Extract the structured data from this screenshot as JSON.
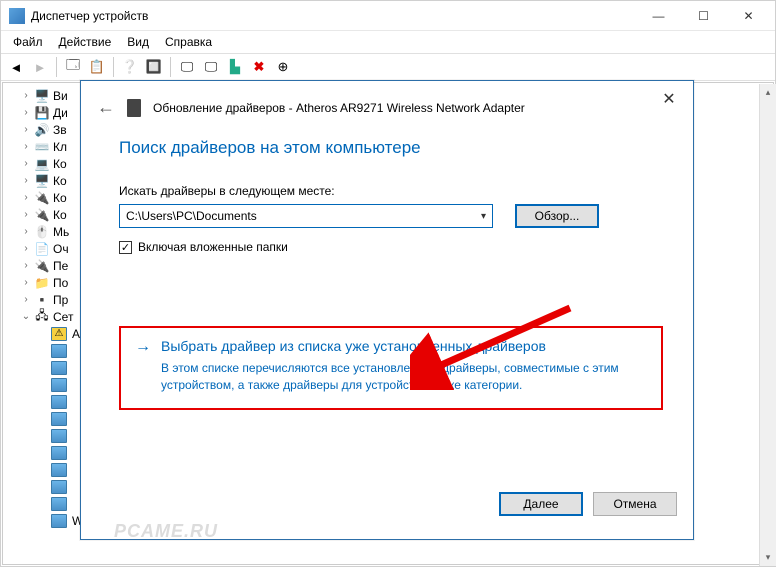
{
  "window": {
    "title": "Диспетчер устройств"
  },
  "menu": {
    "file": "Файл",
    "action": "Действие",
    "view": "Вид",
    "help": "Справка"
  },
  "tree": {
    "items": [
      {
        "label": "Ви",
        "icon": "🖥️"
      },
      {
        "label": "Ди",
        "icon": "💾"
      },
      {
        "label": "Зв",
        "icon": "🔊"
      },
      {
        "label": "Кл",
        "icon": "⌨️"
      },
      {
        "label": "Ко",
        "icon": "💻"
      },
      {
        "label": "Ко",
        "icon": "🖥️"
      },
      {
        "label": "Ко",
        "icon": "🔌"
      },
      {
        "label": "Ко",
        "icon": "🔌"
      },
      {
        "label": "Мь",
        "icon": "🖱️"
      },
      {
        "label": "Оч",
        "icon": "📄"
      },
      {
        "label": "Пе",
        "icon": "🔌"
      },
      {
        "label": "По",
        "icon": "📁"
      },
      {
        "label": "Пр",
        "icon": "▪️"
      },
      {
        "label": "Сет",
        "icon": "🖧",
        "expanded": true
      },
      {
        "label": "A",
        "child": true,
        "warn": true
      },
      {
        "label": "",
        "child": true
      },
      {
        "label": "",
        "child": true
      },
      {
        "label": "",
        "child": true
      },
      {
        "label": "",
        "child": true
      },
      {
        "label": "",
        "child": true
      },
      {
        "label": "",
        "child": true
      },
      {
        "label": "",
        "child": true
      },
      {
        "label": "",
        "child": true
      },
      {
        "label": "",
        "child": true
      },
      {
        "label": "",
        "child": true
      },
      {
        "label": "WAN Miniport (PPTP)",
        "child": true
      }
    ]
  },
  "dialog": {
    "title": "Обновление драйверов - Atheros AR9271 Wireless Network Adapter",
    "heading": "Поиск драйверов на этом компьютере",
    "path_label": "Искать драйверы в следующем месте:",
    "path_value": "C:\\Users\\PC\\Documents",
    "browse": "Обзор...",
    "include_sub": "Включая вложенные папки",
    "pick_title": "Выбрать драйвер из списка уже установленных драйверов",
    "pick_desc": "В этом списке перечисляются все установленные драйверы, совместимые с этим устройством, а также драйверы для устройств той же категории.",
    "next": "Далее",
    "cancel": "Отмена"
  },
  "watermark": "PCAME.RU"
}
